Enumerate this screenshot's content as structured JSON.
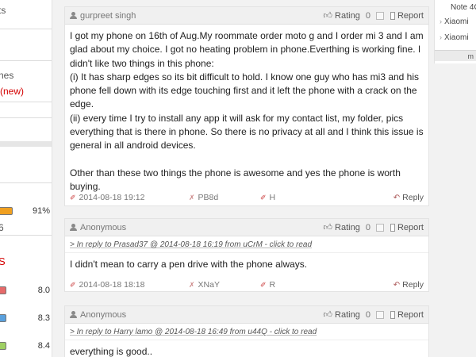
{
  "left_sidebar": {
    "text_top": "ts",
    "text_mid1": "nes",
    "text_mid2": "(new)",
    "percent": "91%",
    "small_num": "6",
    "section_letter": "S",
    "scores": [
      "8.0",
      "8.3",
      "8.4"
    ],
    "bar_colors": [
      "#e66a6a",
      "#5aa0dd",
      "#9fd063"
    ],
    "percent_bar_color": "#f0a020"
  },
  "right_sidebar": {
    "items": [
      "Note 4G",
      "Xiaomi",
      "Xiaomi"
    ],
    "more_label": "m"
  },
  "comments": [
    {
      "author": "gurpreet singh",
      "rating_label": "Rating",
      "rating_value": "0",
      "report_label": "Report",
      "reply_to": "",
      "body": "I got my phone on 16th of Aug.My roommate order moto g and I order mi 3 and I am glad about my choice. I got no heating problem in phone.Everthing is working fine. I didn't like two things in this phone:\n(i) It has sharp edges so its bit difficult to hold. I know one guy who has mi3 and his phone fell down with its edge touching first and it left the phone with a crack on the edge.\n(ii) every time I try to install any app it will ask for my contact list, my folder, pics everything that is there in phone. So there is no privacy at all and I think this issue is general in all android devices.\n\nOther than these two things the phone is awesome and yes the phone is worth buying.",
      "date": "2014-08-18 19:12",
      "device": "PB8d",
      "location": "H",
      "reply_label": "Reply"
    },
    {
      "author": "Anonymous",
      "rating_label": "Rating",
      "rating_value": "0",
      "report_label": "Report",
      "reply_to": "> In reply to Prasad37 @ 2014-08-18 16:19 from uCrM - click to read",
      "body": "I didn't mean to carry a pen drive with the phone always.",
      "date": "2014-08-18 18:18",
      "device": "XNaY",
      "location": "R",
      "reply_label": "Reply"
    },
    {
      "author": "Anonymous",
      "rating_label": "Rating",
      "rating_value": "0",
      "report_label": "Report",
      "reply_to": "> In reply to Harry lamo @ 2014-08-18 16:49 from u44Q - click to read",
      "body": "everything is good..",
      "date": "",
      "device": "",
      "location": "",
      "reply_label": ""
    }
  ]
}
